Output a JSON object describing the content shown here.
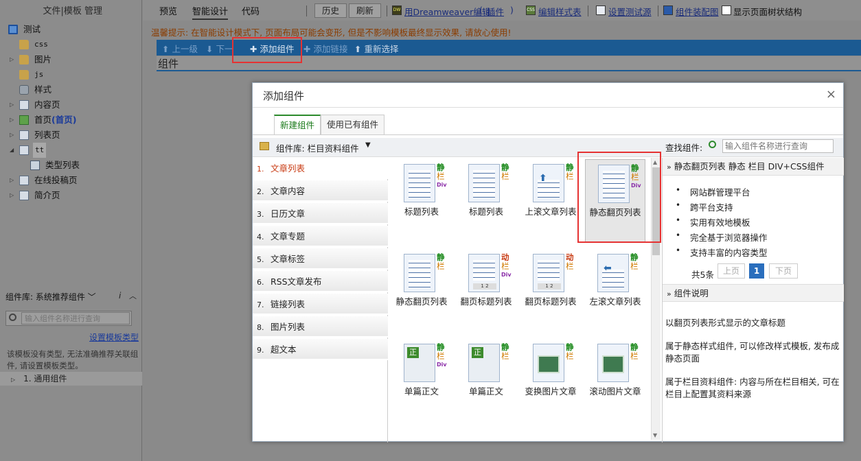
{
  "sidebar": {
    "top_menu": "文件|模板 管理",
    "tree": [
      {
        "label": "测试",
        "icon": "monitor-icon"
      },
      {
        "label": "css",
        "icon": "folder-icon"
      },
      {
        "label": "图片",
        "icon": "folder-icon"
      },
      {
        "label": "js",
        "icon": "folder-icon"
      },
      {
        "label": "样式",
        "icon": "gear-icon"
      },
      {
        "label": "内容页",
        "icon": "page-icon"
      },
      {
        "label": "首页",
        "extra": "(首页)",
        "icon": "home-icon"
      },
      {
        "label": "列表页",
        "icon": "page-icon"
      },
      {
        "label": "tt",
        "icon": "page-icon"
      },
      {
        "label": "类型列表",
        "icon": "document-icon"
      },
      {
        "label": "在线投稿页",
        "icon": "page-icon"
      },
      {
        "label": "简介页",
        "icon": "page-icon"
      }
    ],
    "lib_label": "组件库: 系统推荐组件",
    "info_icon": "i",
    "search_placeholder": "输入组件名称进行查询",
    "setup_link": "设置模板类型",
    "note": "该模板没有类型, 无法准确推荐关联组件, 请设置模板类型。",
    "group": "1. 通用组件"
  },
  "toolbar": {
    "tabs": [
      "预览",
      "智能设计",
      "代码"
    ],
    "history": "历史",
    "refresh": "刷新",
    "dw_badge": "DW",
    "dw_link": "用Dreamweaver编辑",
    "plugin_link": "插件",
    "css_badge": "CSS",
    "edit_style": "编辑样式表",
    "set_source": "设置测试源",
    "assembly": "组件装配图",
    "tree_checkbox": "显示页面树状结构"
  },
  "notice": "温馨提示: 在智能设计模式下, 页面布局可能会变形, 但是不影响模板最终显示效果, 请放心使用!",
  "actions": {
    "up": "上一级",
    "next": "下一",
    "add": "添加组件",
    "link": "添加链接",
    "reselect": "重新选择"
  },
  "component_field": "组件",
  "modal": {
    "title": "添加组件",
    "close": "×",
    "tabs": [
      "新建组件",
      "使用已有组件"
    ],
    "lib_label": "组件库:  栏目资料组件",
    "find_label": "查找组件:",
    "find_placeholder": "输入组件名称进行查询",
    "categories": [
      {
        "n": "1.",
        "label": "文章列表"
      },
      {
        "n": "2.",
        "label": "文章内容"
      },
      {
        "n": "3.",
        "label": "日历文章"
      },
      {
        "n": "4.",
        "label": "文章专题"
      },
      {
        "n": "5.",
        "label": "文章标签"
      },
      {
        "n": "6.",
        "label": "RSS文章发布"
      },
      {
        "n": "7.",
        "label": "链接列表"
      },
      {
        "n": "8.",
        "label": "图片列表"
      },
      {
        "n": "9.",
        "label": "超文本"
      }
    ],
    "components": [
      {
        "name": "标题列表",
        "t1": "静",
        "t2": "栏",
        "t3": "Div",
        "kind": "list"
      },
      {
        "name": "标题列表",
        "t1": "静",
        "t2": "栏",
        "t3": "",
        "kind": "list"
      },
      {
        "name": "上滚文章列表",
        "t1": "静",
        "t2": "栏",
        "t3": "",
        "kind": "up"
      },
      {
        "name": "静态翻页列表",
        "t1": "静",
        "t2": "栏",
        "t3": "Div",
        "kind": "list"
      },
      {
        "name": "静态翻页列表",
        "t1": "静",
        "t2": "栏",
        "t3": "",
        "kind": "list"
      },
      {
        "name": "翻页标题列表",
        "t1": "动",
        "t2": "栏",
        "t3": "Div",
        "kind": "pager"
      },
      {
        "name": "翻页标题列表",
        "t1": "动",
        "t2": "栏",
        "t3": "",
        "kind": "pager"
      },
      {
        "name": "左滚文章列表",
        "t1": "静",
        "t2": "栏",
        "t3": "",
        "kind": "left"
      },
      {
        "name": "单篇正文",
        "t1": "静",
        "t2": "栏",
        "t3": "Div",
        "kind": "zheng"
      },
      {
        "name": "单篇正文",
        "t1": "静",
        "t2": "栏",
        "t3": "",
        "kind": "zheng"
      },
      {
        "name": "变换图片文章",
        "t1": "静",
        "t2": "栏",
        "t3": "",
        "kind": "pic"
      },
      {
        "name": "滚动图片文章",
        "t1": "静",
        "t2": "栏",
        "t3": "",
        "kind": "pic2"
      }
    ],
    "pager_numbers": "1 2",
    "detail": {
      "title": "静态翻页列表 静态 栏目 DIV+CSS组件",
      "features": [
        "网站群管理平台",
        "跨平台支持",
        "实用有效地模板",
        "完全基于浏览器操作",
        "支持丰富的内容类型"
      ],
      "count": "共5条",
      "prev": "上页",
      "page": "1",
      "next": "下页",
      "desc_title": "组件说明",
      "desc": [
        "以翻页列表形式显示的文章标题",
        "属于静态样式组件, 可以修改样式模板, 发布成静态页面",
        "属于栏目资料组件: 内容与所在栏目相关, 可在栏目上配置其资料来源"
      ]
    }
  },
  "colors": {
    "accent_blue": "#1b5a92",
    "highlight_red": "#e53232",
    "green_static": "#1d8a1d",
    "orange_column": "#d07a00"
  }
}
